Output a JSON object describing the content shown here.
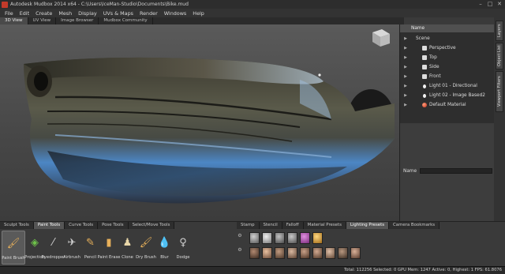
{
  "window": {
    "title": "Autodesk Mudbox 2014 x64 - C:\\Users\\IceMan-Studio\\Documents\\Bike.mud",
    "controls": [
      "minimize",
      "maximize",
      "close"
    ]
  },
  "menu": [
    "File",
    "Edit",
    "Create",
    "Mesh",
    "Display",
    "UVs & Maps",
    "Render",
    "Windows",
    "Help"
  ],
  "view_tabs": [
    {
      "label": "3D View",
      "active": true
    },
    {
      "label": "UV View",
      "active": false
    },
    {
      "label": "Image Browser",
      "active": false
    },
    {
      "label": "Mudbox Community",
      "active": false
    }
  ],
  "object_list": {
    "header": "Name",
    "items": [
      {
        "label": "Scene",
        "icon": "scene",
        "indent": 0
      },
      {
        "label": "Perspective",
        "icon": "camera-icon",
        "indent": 1
      },
      {
        "label": "Top",
        "icon": "camera-icon",
        "indent": 1
      },
      {
        "label": "Side",
        "icon": "camera-icon",
        "indent": 1
      },
      {
        "label": "Front",
        "icon": "camera-icon",
        "indent": 1
      },
      {
        "label": "Light 01 - Directional",
        "icon": "light-icon",
        "indent": 1
      },
      {
        "label": "Light 02 - Image Based2",
        "icon": "light-icon",
        "indent": 1
      },
      {
        "label": "Default Material",
        "icon": "material-icon",
        "indent": 1
      }
    ],
    "name_label": "Name",
    "name_value": ""
  },
  "side_tabs": [
    "Layers",
    "Object List",
    "Viewport Filters"
  ],
  "tray_tabs_left": [
    {
      "label": "Sculpt Tools",
      "active": false
    },
    {
      "label": "Paint Tools",
      "active": true
    },
    {
      "label": "Curve Tools",
      "active": false
    },
    {
      "label": "Pose Tools",
      "active": false
    },
    {
      "label": "Select/Move Tools",
      "active": false
    }
  ],
  "tray_tabs_right": [
    {
      "label": "Stamp",
      "active": false
    },
    {
      "label": "Stencil",
      "active": false
    },
    {
      "label": "Falloff",
      "active": false
    },
    {
      "label": "Material Presets",
      "active": false
    },
    {
      "label": "Lighting Presets",
      "active": true
    },
    {
      "label": "Camera Bookmarks",
      "active": false
    }
  ],
  "paint_tools": [
    {
      "label": "Paint Brush",
      "icon": "paintbrush-icon",
      "active": true
    },
    {
      "label": "Projection",
      "icon": "projection-icon",
      "active": false
    },
    {
      "label": "Eyedropper",
      "icon": "eyedropper-icon",
      "active": false
    },
    {
      "label": "Airbrush",
      "icon": "airbrush-icon",
      "active": false
    },
    {
      "label": "Pencil",
      "icon": "pencil-icon",
      "active": false
    },
    {
      "label": "Paint Erase",
      "icon": "eraser-icon",
      "active": false
    },
    {
      "label": "Clone",
      "icon": "clone-icon",
      "active": false
    },
    {
      "label": "Dry Brush",
      "icon": "drybrush-icon",
      "active": false
    },
    {
      "label": "Blur",
      "icon": "blur-icon",
      "active": false
    },
    {
      "label": "Dodge",
      "icon": "dodge-icon",
      "active": false
    }
  ],
  "lighting_presets": {
    "row1_colors": [
      "#8a8a8a",
      "#b9b9b9",
      "#7a7a7a",
      "#7f7f7f",
      "#b04fb0",
      "#e0b045"
    ],
    "row2_colors": [
      "#6a4a3a",
      "#a47a60",
      "#7a6050",
      "#9a8070",
      "#806050",
      "#8a6a5a",
      "#9a7a6a",
      "#6a5a50",
      "#a08070"
    ]
  },
  "status": {
    "text": "Total: 112256   Selected: 0 GPU Mem: 1247   Active: 0, Highest: 1   FPS: 61.8076"
  },
  "colors": {
    "accent": "#c23a2a",
    "model_blue": "#4c86c4",
    "model_dark": "#2c2c24"
  }
}
